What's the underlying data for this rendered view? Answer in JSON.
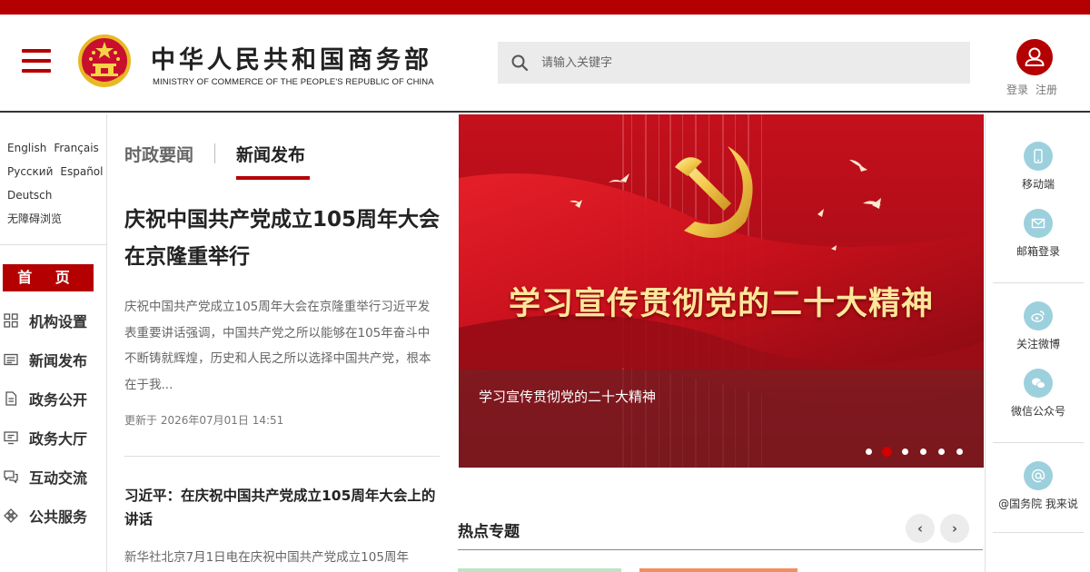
{
  "header": {
    "site_title": "中华人民共和国商务部",
    "site_subtitle": "MINISTRY OF COMMERCE OF THE PEOPLE'S REPUBLIC OF CHINA",
    "search_placeholder": "请输入关键字",
    "login_label": "登录",
    "register_label": "注册",
    "brand_color": "#b40000"
  },
  "languages": {
    "english": "English",
    "french": "Français",
    "russian": "Русский",
    "spanish": "Español",
    "german": "Deutsch",
    "accessibility": "无障碍浏览"
  },
  "nav": {
    "home": "首 页",
    "items": [
      {
        "label": "机构设置",
        "icon": "grid-icon"
      },
      {
        "label": "新闻发布",
        "icon": "newspaper-icon"
      },
      {
        "label": "政务公开",
        "icon": "document-icon"
      },
      {
        "label": "政务大厅",
        "icon": "monitor-icon"
      },
      {
        "label": "互动交流",
        "icon": "chat-icon"
      },
      {
        "label": "公共服务",
        "icon": "service-icon"
      }
    ]
  },
  "news": {
    "tabs": [
      "时政要闻",
      "新闻发布"
    ],
    "active_tab": "新闻发布",
    "lead": {
      "title": "庆祝中国共产党成立105周年大会在京隆重举行",
      "summary": "庆祝中国共产党成立105周年大会在京隆重举行习近平发表重要讲话强调，中国共产党之所以能够在105年奋斗中不断铸就辉煌，历史和人民之所以选择中国共产党，根本在于我...",
      "time": "更新于 2026年07月01日 14:51"
    },
    "second": {
      "title": "习近平：在庆祝中国共产党成立105周年大会上的讲话",
      "summary": "新华社北京7月1日电在庆祝中国共产党成立105周年"
    }
  },
  "banner": {
    "headline": "学习宣传贯彻党的二十大精神",
    "caption": "学习宣传贯彻党的二十大精神",
    "slide_count": 6,
    "active_slide": 2
  },
  "hot_topics": {
    "title": "热点专题",
    "prev": "‹",
    "next": "›"
  },
  "right_panel": {
    "mobile": "移动端",
    "mail_login": "邮箱登录",
    "weibo": "关注微博",
    "wechat": "微信公众号",
    "state_council": "@国务院 我来说"
  }
}
